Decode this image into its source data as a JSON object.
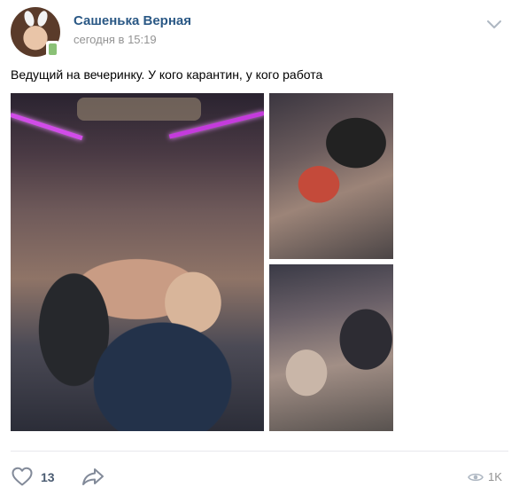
{
  "post": {
    "author": "Сашенька Верная",
    "time": "сегодня в 15:19",
    "text": "Ведущий на вечеринку. У кого карантин, у кого работа"
  },
  "footer": {
    "likes": "13",
    "views": "1K"
  },
  "icons": {
    "menu": "chevron-down-icon",
    "like": "heart-icon",
    "share": "share-arrow-icon",
    "views": "eye-icon",
    "online": "mobile-online-icon"
  },
  "colors": {
    "author": "#2a5885",
    "secondary": "#939393",
    "counter": "#4a5b71",
    "online": "#8ac176"
  }
}
